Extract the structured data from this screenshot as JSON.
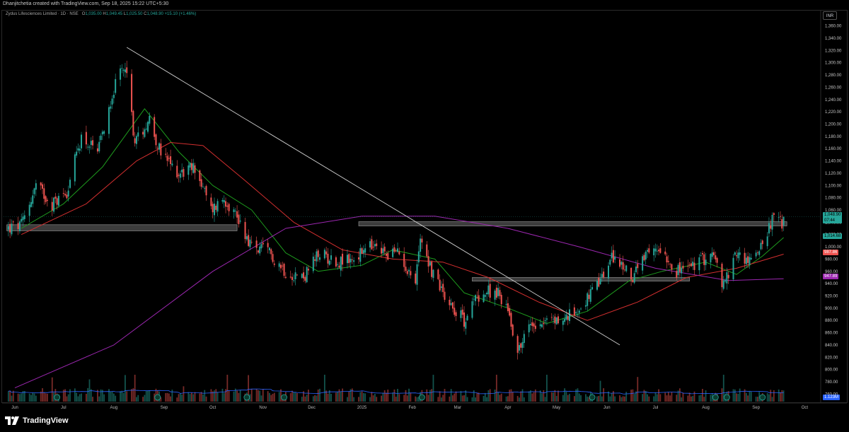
{
  "attribution": "Dhanjitchetia created with TradingView.com, Sep 18, 2025 15:22 UTC+5:30",
  "legend": {
    "title": "Zydus Lifesciences Limited · 1D · NSE",
    "o_label": "O",
    "o_value": "1,035.00",
    "h_label": "H",
    "h_value": "1,049.45",
    "l_label": "L",
    "l_value": "1,025.50",
    "c_label": "C",
    "c_value": "1,048.90",
    "change": "+15.10 (+1.46%)"
  },
  "currency": "INR",
  "badges": {
    "last_price": "1,048.90",
    "countdown": "07:44",
    "sma20": "1,014.68",
    "sma50": "987.86",
    "sma200": "947.89",
    "volume": "1.123M"
  },
  "footer": {
    "brand": "TradingView",
    "logo_icon": "tradingview-logo-icon"
  },
  "colors": {
    "up": "#26a69a",
    "down": "#ef5350",
    "sma20": "#1e9c1e",
    "sma50": "#d32f2f",
    "sma200": "#9c27b0",
    "volume_ma": "#2962ff",
    "zone": "#6d6d6d"
  },
  "chart_data": {
    "type": "candlestick",
    "ylim": [
      750,
      1370
    ],
    "y_ticks": [
      "760.00",
      "780.00",
      "800.00",
      "820.00",
      "840.00",
      "860.00",
      "880.00",
      "900.00",
      "920.00",
      "940.00",
      "960.00",
      "980.00",
      "1,000.00",
      "1,020.00",
      "1,040.00",
      "1,060.00",
      "1,080.00",
      "1,100.00",
      "1,120.00",
      "1,140.00",
      "1,160.00",
      "1,180.00",
      "1,200.00",
      "1,220.00",
      "1,240.00",
      "1,260.00",
      "1,280.00",
      "1,300.00",
      "1,320.00",
      "1,340.00",
      "1,360.00"
    ],
    "x_ticks": [
      "Jun",
      "Jul",
      "Aug",
      "Sep",
      "Oct",
      "Nov",
      "Dec",
      "2025",
      "Feb",
      "Mar",
      "Apr",
      "May",
      "Jun",
      "Jul",
      "Aug",
      "Sep",
      "Oct"
    ],
    "x_tick_dates": [
      "2024-06-01",
      "2024-07-01",
      "2024-08-01",
      "2024-09-01",
      "2024-10-01",
      "2024-11-01",
      "2024-12-01",
      "2025-01-01",
      "2025-02-01",
      "2025-03-01",
      "2025-04-01",
      "2025-05-01",
      "2025-06-01",
      "2025-07-01",
      "2025-08-01",
      "2025-09-01",
      "2025-10-01"
    ],
    "price_path": [
      {
        "date": "2024-05-28",
        "price": 1030
      },
      {
        "date": "2024-06-05",
        "price": 1035
      },
      {
        "date": "2024-06-14",
        "price": 1100
      },
      {
        "date": "2024-06-24",
        "price": 1070
      },
      {
        "date": "2024-07-03",
        "price": 1090
      },
      {
        "date": "2024-07-12",
        "price": 1180
      },
      {
        "date": "2024-07-22",
        "price": 1150
      },
      {
        "date": "2024-07-31",
        "price": 1250
      },
      {
        "date": "2024-08-08",
        "price": 1300
      },
      {
        "date": "2024-08-14",
        "price": 1170
      },
      {
        "date": "2024-08-23",
        "price": 1210
      },
      {
        "date": "2024-08-30",
        "price": 1150
      },
      {
        "date": "2024-09-10",
        "price": 1120
      },
      {
        "date": "2024-09-20",
        "price": 1130
      },
      {
        "date": "2024-09-30",
        "price": 1060
      },
      {
        "date": "2024-10-08",
        "price": 1080
      },
      {
        "date": "2024-10-16",
        "price": 1050
      },
      {
        "date": "2024-10-25",
        "price": 1000
      },
      {
        "date": "2024-11-05",
        "price": 990
      },
      {
        "date": "2024-11-15",
        "price": 960
      },
      {
        "date": "2024-11-26",
        "price": 950
      },
      {
        "date": "2024-12-06",
        "price": 990
      },
      {
        "date": "2024-12-17",
        "price": 975
      },
      {
        "date": "2024-12-27",
        "price": 980
      },
      {
        "date": "2025-01-06",
        "price": 1000
      },
      {
        "date": "2025-01-15",
        "price": 990
      },
      {
        "date": "2025-01-24",
        "price": 990
      },
      {
        "date": "2025-02-03",
        "price": 940
      },
      {
        "date": "2025-02-06",
        "price": 1020
      },
      {
        "date": "2025-02-13",
        "price": 960
      },
      {
        "date": "2025-02-24",
        "price": 910
      },
      {
        "date": "2025-03-05",
        "price": 880
      },
      {
        "date": "2025-03-13",
        "price": 920
      },
      {
        "date": "2025-03-24",
        "price": 930
      },
      {
        "date": "2025-04-01",
        "price": 900
      },
      {
        "date": "2025-04-07",
        "price": 830
      },
      {
        "date": "2025-04-15",
        "price": 875
      },
      {
        "date": "2025-04-24",
        "price": 880
      },
      {
        "date": "2025-05-05",
        "price": 880
      },
      {
        "date": "2025-05-15",
        "price": 900
      },
      {
        "date": "2025-05-26",
        "price": 935
      },
      {
        "date": "2025-06-05",
        "price": 985
      },
      {
        "date": "2025-06-16",
        "price": 950
      },
      {
        "date": "2025-06-26",
        "price": 985
      },
      {
        "date": "2025-07-04",
        "price": 1000
      },
      {
        "date": "2025-07-14",
        "price": 960
      },
      {
        "date": "2025-07-25",
        "price": 970
      },
      {
        "date": "2025-08-05",
        "price": 990
      },
      {
        "date": "2025-08-12",
        "price": 935
      },
      {
        "date": "2025-08-20",
        "price": 990
      },
      {
        "date": "2025-08-28",
        "price": 975
      },
      {
        "date": "2025-09-05",
        "price": 1010
      },
      {
        "date": "2025-09-12",
        "price": 1050
      },
      {
        "date": "2025-09-17",
        "price": 1035
      },
      {
        "date": "2025-09-18",
        "price": 1048.9
      }
    ],
    "moving_averages": [
      {
        "name": "sma20",
        "path": [
          {
            "date": "2024-06-05",
            "price": 1030
          },
          {
            "date": "2024-07-01",
            "price": 1070
          },
          {
            "date": "2024-07-25",
            "price": 1130
          },
          {
            "date": "2024-08-20",
            "price": 1225
          },
          {
            "date": "2024-09-10",
            "price": 1155
          },
          {
            "date": "2024-10-01",
            "price": 1100
          },
          {
            "date": "2024-10-25",
            "price": 1060
          },
          {
            "date": "2024-11-15",
            "price": 990
          },
          {
            "date": "2024-12-05",
            "price": 960
          },
          {
            "date": "2025-01-01",
            "price": 970
          },
          {
            "date": "2025-01-20",
            "price": 995
          },
          {
            "date": "2025-02-15",
            "price": 980
          },
          {
            "date": "2025-03-05",
            "price": 925
          },
          {
            "date": "2025-04-01",
            "price": 900
          },
          {
            "date": "2025-04-25",
            "price": 875
          },
          {
            "date": "2025-05-20",
            "price": 895
          },
          {
            "date": "2025-06-15",
            "price": 945
          },
          {
            "date": "2025-07-05",
            "price": 960
          },
          {
            "date": "2025-08-01",
            "price": 975
          },
          {
            "date": "2025-08-20",
            "price": 955
          },
          {
            "date": "2025-09-05",
            "price": 985
          },
          {
            "date": "2025-09-18",
            "price": 1015
          }
        ]
      },
      {
        "name": "sma50",
        "path": [
          {
            "date": "2024-06-05",
            "price": 1020
          },
          {
            "date": "2024-07-15",
            "price": 1070
          },
          {
            "date": "2024-08-15",
            "price": 1140
          },
          {
            "date": "2024-09-05",
            "price": 1170
          },
          {
            "date": "2024-09-25",
            "price": 1165
          },
          {
            "date": "2024-10-20",
            "price": 1110
          },
          {
            "date": "2024-11-20",
            "price": 1040
          },
          {
            "date": "2024-12-20",
            "price": 995
          },
          {
            "date": "2025-01-20",
            "price": 980
          },
          {
            "date": "2025-02-20",
            "price": 975
          },
          {
            "date": "2025-03-20",
            "price": 950
          },
          {
            "date": "2025-04-20",
            "price": 910
          },
          {
            "date": "2025-05-20",
            "price": 880
          },
          {
            "date": "2025-06-20",
            "price": 910
          },
          {
            "date": "2025-07-20",
            "price": 950
          },
          {
            "date": "2025-08-20",
            "price": 965
          },
          {
            "date": "2025-09-18",
            "price": 988
          }
        ]
      },
      {
        "name": "sma200",
        "path": [
          {
            "date": "2024-06-01",
            "price": 770
          },
          {
            "date": "2024-08-01",
            "price": 840
          },
          {
            "date": "2024-10-01",
            "price": 960
          },
          {
            "date": "2024-11-15",
            "price": 1030
          },
          {
            "date": "2025-01-01",
            "price": 1050
          },
          {
            "date": "2025-02-15",
            "price": 1050
          },
          {
            "date": "2025-04-01",
            "price": 1030
          },
          {
            "date": "2025-05-15",
            "price": 1000
          },
          {
            "date": "2025-07-01",
            "price": 965
          },
          {
            "date": "2025-08-15",
            "price": 945
          },
          {
            "date": "2025-09-18",
            "price": 948
          }
        ]
      }
    ],
    "trendline": {
      "from": {
        "date": "2024-08-09",
        "price": 1325
      },
      "to": {
        "date": "2025-06-09",
        "price": 840
      }
    },
    "zones": [
      {
        "from": "2024-05-27",
        "to": "2024-10-16",
        "low": 1026,
        "high": 1036
      },
      {
        "from": "2024-12-30",
        "to": "2025-09-20",
        "low": 1034,
        "high": 1041
      },
      {
        "from": "2025-03-10",
        "to": "2025-07-22",
        "low": 944,
        "high": 950
      }
    ],
    "price_badge_values": [
      1048.9,
      1014.68,
      987.86,
      947.89
    ],
    "volume": {
      "max_label": "1.123M",
      "event_markers": [
        "2024-06-27",
        "2024-08-28",
        "2024-10-22",
        "2024-11-14",
        "2025-02-07",
        "2025-05-23",
        "2025-08-07",
        "2025-08-14",
        "2025-09-05"
      ]
    }
  }
}
